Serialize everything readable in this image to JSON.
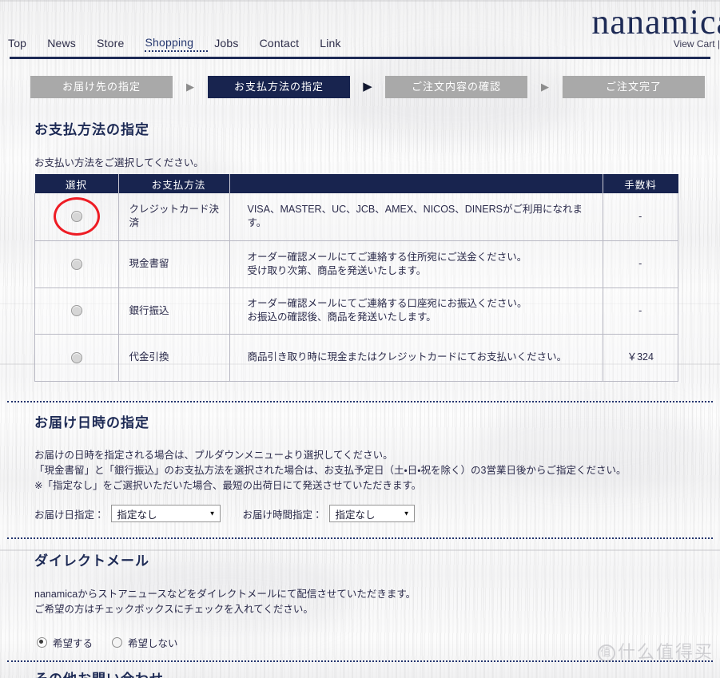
{
  "header": {
    "brand": "nanamica",
    "view_cart": "View Cart |",
    "nav": [
      {
        "label": "Top",
        "active": false
      },
      {
        "label": "News",
        "active": false
      },
      {
        "label": "Store",
        "active": false
      },
      {
        "label": "Shopping",
        "active": true
      },
      {
        "label": "Jobs",
        "active": false
      },
      {
        "label": "Contact",
        "active": false
      },
      {
        "label": "Link",
        "active": false
      }
    ]
  },
  "steps": {
    "items": [
      {
        "label": "お届け先の指定",
        "current": false
      },
      {
        "label": "お支払方法の指定",
        "current": true
      },
      {
        "label": "ご注文内容の確認",
        "current": false
      },
      {
        "label": "ご注文完了",
        "current": false
      }
    ],
    "arrow_glyph": "▶"
  },
  "payment": {
    "title": "お支払方法の指定",
    "note": "お支払い方法をご選択してください。",
    "columns": [
      "選択",
      "お支払方法",
      "",
      "手数料"
    ],
    "rows": [
      {
        "method": "クレジットカード決済",
        "desc_line1": "VISA、MASTER、UC、JCB、AMEX、NICOS、DINERSがご利用になれます。",
        "desc_line2": "",
        "fee": "-",
        "selected": false,
        "highlighted": true
      },
      {
        "method": "現金書留",
        "desc_line1": "オーダー確認メールにてご連絡する住所宛にご送金ください。",
        "desc_line2": "受け取り次第、商品を発送いたします。",
        "fee": "-",
        "selected": false,
        "highlighted": false
      },
      {
        "method": "銀行振込",
        "desc_line1": "オーダー確認メールにてご連絡する口座宛にお振込ください。",
        "desc_line2": "お振込の確認後、商品を発送いたします。",
        "fee": "-",
        "selected": false,
        "highlighted": false
      },
      {
        "method": "代金引換",
        "desc_line1": "商品引き取り時に現金またはクレジットカードにてお支払いください。",
        "desc_line2": "",
        "fee": "￥324",
        "selected": false,
        "highlighted": false
      }
    ]
  },
  "delivery": {
    "title": "お届け日時の指定",
    "note_line1": "お届けの日時を指定される場合は、プルダウンメニューより選択してください。",
    "note_line2": "「現金書留」と「銀行振込」のお支払方法を選択された場合は、お支払予定日（土・日・祝を除く）の3営業日後からご指定ください。",
    "note_line3": "※「指定なし」をご選択いただいた場合、最短の出荷日にて発送させていただきます。",
    "date_label": "お届け日指定：",
    "date_value": "指定なし",
    "time_label": "お届け時間指定：",
    "time_value": "指定なし",
    "caret_glyph": "▼"
  },
  "direct_mail": {
    "title": "ダイレクトメール",
    "note_line1": "nanamicaからストアニュースなどをダイレクトメールにて配信させていただきます。",
    "note_line2": "ご希望の方はチェックボックスにチェックを入れてください。",
    "options": [
      {
        "label": "希望する",
        "checked": true
      },
      {
        "label": "希望しない",
        "checked": false
      }
    ]
  },
  "bottom": {
    "title": "その他お問い合わせ"
  },
  "watermark": {
    "mark": "值",
    "text": "什么值得买"
  },
  "colors": {
    "navy": "#18244f",
    "step_inactive": "#a9a9a9",
    "highlight_red": "#ee1c24"
  }
}
